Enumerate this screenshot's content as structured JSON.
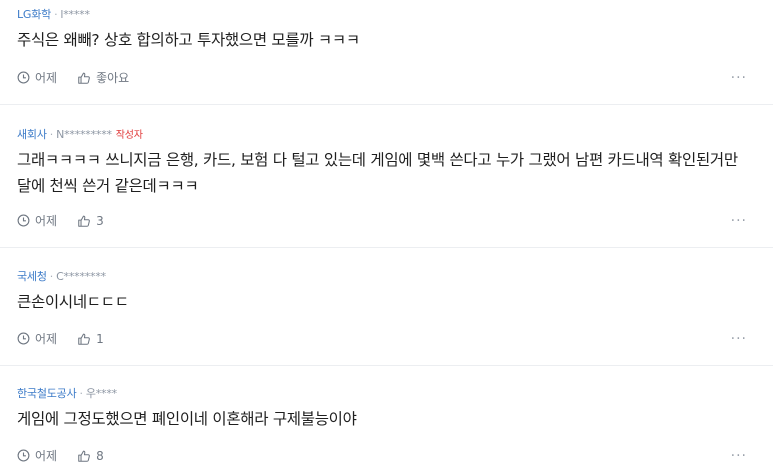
{
  "comments": [
    {
      "company": "LG화학",
      "author": "l*****",
      "author_tag": "",
      "text": "주식은 왜빼? 상호 합의하고 투자했으면 모를까 ㅋㅋㅋ",
      "time": "어제",
      "like": "좋아요"
    },
    {
      "company": "새회사",
      "author": "N*********",
      "author_tag": "작성자",
      "text": "그래ㅋㅋㅋㅋ 쓰니지금 은행, 카드, 보험 다 털고 있는데 게임에 몇백 쓴다고 누가 그랬어 남편 카드내역 확인된거만 달에 천씩 쓴거 같은데ㅋㅋㅋ",
      "time": "어제",
      "like": "3"
    },
    {
      "company": "국세청",
      "author": "C********",
      "author_tag": "",
      "text": "큰손이시네ㄷㄷㄷ",
      "time": "어제",
      "like": "1"
    },
    {
      "company": "한국철도공사",
      "author": "우****",
      "author_tag": "",
      "text": "게임에 그정도했으면 폐인이네 이혼해라 구제불능이야",
      "time": "어제",
      "like": "8"
    }
  ],
  "separator": "·",
  "more_label": "···",
  "icons": {
    "time": "clock-icon",
    "like": "thumbs-up-icon"
  }
}
